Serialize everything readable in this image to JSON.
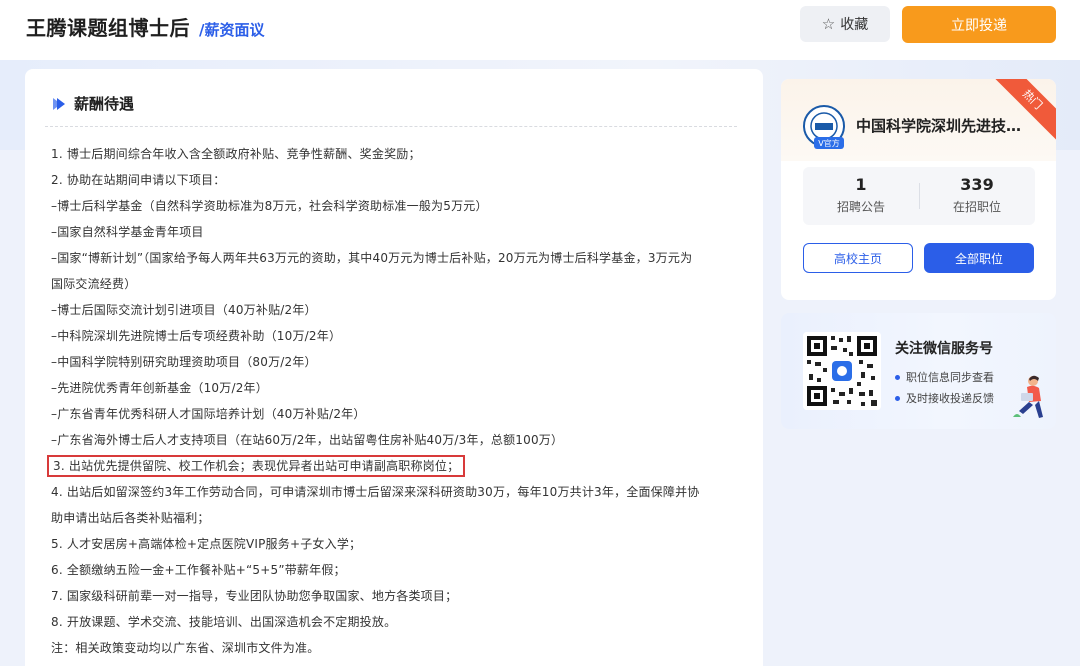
{
  "header": {
    "title": "王腾课题组博士后",
    "salary_tag": "/薪资面议",
    "favorite_label": "收藏",
    "apply_label": "立即投递"
  },
  "colors": {
    "accent_blue": "#2b5ee8",
    "apply_orange": "#f89a1c",
    "highlight_red": "#d83a3a",
    "hot_red": "#f05a3a"
  },
  "benefits": {
    "section_title": "薪酬待遇",
    "items": [
      "1. 博士后期间综合年收入含全额政府补贴、竞争性薪酬、奖金奖励；",
      "2. 协助在站期间申请以下项目：",
      "–博士后科学基金（自然科学资助标准为8万元，社会科学资助标准一般为5万元）",
      "–国家自然科学基金青年项目",
      "–国家“博新计划”（国家给予每人两年共63万元的资助，其中40万元为博士后补贴，20万元为博士后科学基金，3万元为",
      "国际交流经费）",
      "–博士后国际交流计划引进项目（40万补贴/2年）",
      "–中科院深圳先进院博士后专项经费补助（10万/2年）",
      "–中国科学院特别研究助理资助项目（80万/2年）",
      "–先进院优秀青年创新基金（10万/2年）",
      "–广东省青年优秀科研人才国际培养计划（40万补贴/2年）",
      "–广东省海外博士后人才支持项目（在站60万/2年，出站留粤住房补贴40万/3年，总额100万）",
      "3. 出站优先提供留院、校工作机会；表现优异者出站可申请副高职称岗位；",
      "4. 出站后如留深签约3年工作劳动合同，可申请深圳市博士后留深来深科研资助30万，每年10万共计3年，全面保障并协",
      "助申请出站后各类补贴福利；",
      "5. 人才安居房+高端体检+定点医院VIP服务+子女入学；",
      "6. 全额缴纳五险一金+工作餐补贴+“5+5”带薪年假；",
      "7. 国家级科研前辈一对一指导，专业团队协助您争取国家、地方各类项目；",
      "8. 开放课题、学术交流、技能培训、出国深造机会不定期投放。",
      "注：相关政策变动均以广东省、深圳市文件为准。"
    ]
  },
  "institution": {
    "name": "中国科学院深圳先进技…",
    "hot_label": "热门",
    "logo_text": "SIAT",
    "verified_label": "V官方",
    "stats": [
      {
        "value": "1",
        "label": "招聘公告"
      },
      {
        "value": "339",
        "label": "在招职位"
      }
    ],
    "home_label": "高校主页",
    "all_jobs_label": "全部职位"
  },
  "wechat": {
    "title": "关注微信服务号",
    "bullets": [
      "职位信息同步查看",
      "及时接收投递反馈"
    ]
  }
}
